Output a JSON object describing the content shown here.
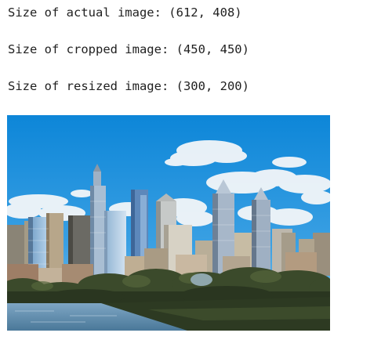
{
  "output": {
    "lines": [
      "Size of actual image: (612, 408)",
      "Size of cropped image: (450, 450)",
      "Size of resized image: (300, 200)"
    ],
    "image": {
      "description_icon": "city-skyline-photo",
      "sky_color": "#1a8fdc",
      "cloud_color": "#f4f6f8",
      "tree_color": "#3a4a2a",
      "water_color": "#5c86a6"
    }
  }
}
